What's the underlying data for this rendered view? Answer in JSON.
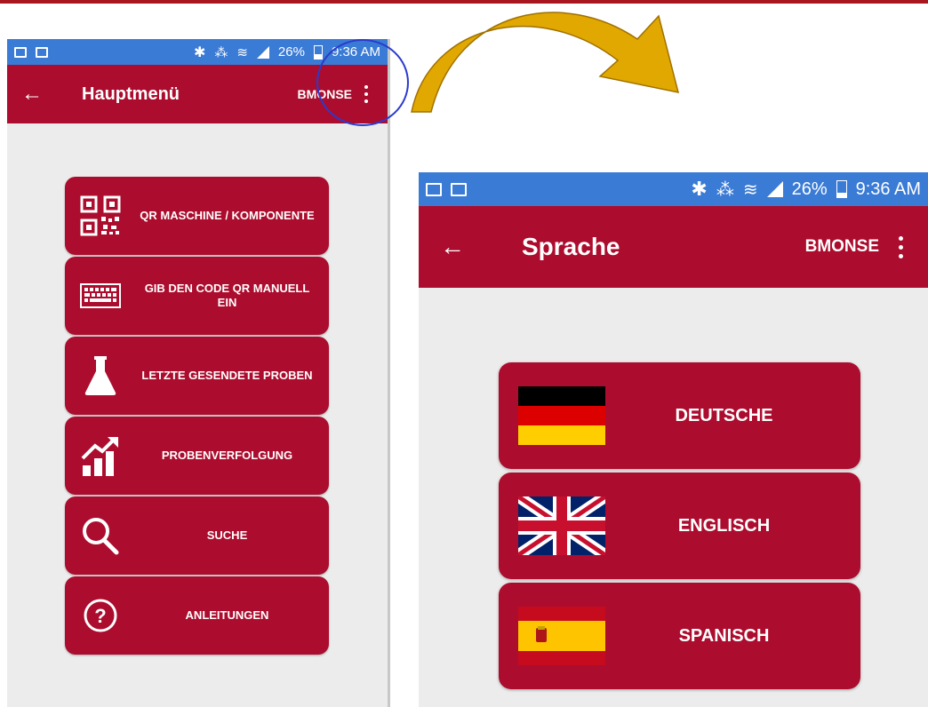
{
  "main_screen": {
    "status_bar": {
      "battery": "26%",
      "time": "9:36 AM"
    },
    "app_bar": {
      "back_icon": "arrow-left-icon",
      "title": "Hauptmenü",
      "user": "BMONSE",
      "more_icon": "more-vert-icon"
    },
    "menu_items": [
      {
        "icon": "qr-code-icon",
        "label": "QR MASCHINE / KOMPONENTE"
      },
      {
        "icon": "keyboard-icon",
        "label": "GIB DEN CODE QR MANUELL EIN"
      },
      {
        "icon": "flask-icon",
        "label": "LETZTE GESENDETE PROBEN"
      },
      {
        "icon": "growth-chart-icon",
        "label": "PROBENVERFOLGUNG"
      },
      {
        "icon": "search-icon",
        "label": "SUCHE"
      },
      {
        "icon": "help-circle-icon",
        "label": "ANLEITUNGEN"
      }
    ]
  },
  "language_screen": {
    "status_bar": {
      "battery": "26%",
      "time": "9:36 AM"
    },
    "app_bar": {
      "back_icon": "arrow-left-icon",
      "title": "Sprache",
      "user": "BMONSE",
      "more_icon": "more-vert-icon"
    },
    "languages": [
      {
        "flag": "germany-flag-icon",
        "label": "DEUTSCHE"
      },
      {
        "flag": "uk-flag-icon",
        "label": "ENGLISCH"
      },
      {
        "flag": "spain-flag-icon",
        "label": "SPANISCH"
      }
    ]
  },
  "colors": {
    "accent": "#ac0c2d",
    "status_bar": "#3a7bd5",
    "background": "#ececec",
    "annotation_circle": "#2a3bcc",
    "arrow": "#e0a800"
  }
}
